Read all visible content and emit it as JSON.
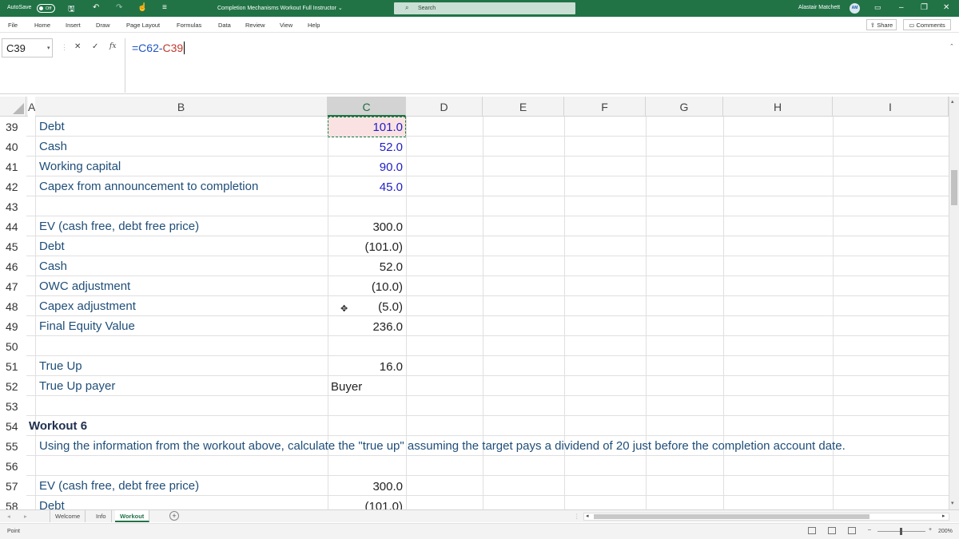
{
  "titlebar": {
    "autosave_label": "AutoSave",
    "autosave_state": "Off",
    "document_title": "Completion Mechanisms Workout Full Instructor",
    "title_dropdown_glyph": "⌄",
    "search_label": "Search",
    "user_name": "Alastair Matchett",
    "user_initials": "AM"
  },
  "menu": {
    "items": [
      "File",
      "Home",
      "Insert",
      "Draw",
      "Page Layout",
      "Formulas",
      "Data",
      "Review",
      "View",
      "Help"
    ],
    "share_label": "Share",
    "comments_label": "Comments"
  },
  "formula_bar": {
    "name_box": "C39",
    "formula_part1": "=C62-",
    "formula_part2": "C39"
  },
  "columns": [
    "A",
    "B",
    "C",
    "D",
    "E",
    "F",
    "G",
    "H",
    "I"
  ],
  "rows": [
    {
      "num": "39",
      "label": "Debt",
      "value": "101.0",
      "style": "blue"
    },
    {
      "num": "40",
      "label": "Cash",
      "value": "52.0",
      "style": "blue"
    },
    {
      "num": "41",
      "label": "Working capital",
      "value": "90.0",
      "style": "blue"
    },
    {
      "num": "42",
      "label": "Capex from announcement to completion",
      "value": "45.0",
      "style": "blue"
    },
    {
      "num": "43",
      "label": "",
      "value": "",
      "style": ""
    },
    {
      "num": "44",
      "label": "EV (cash free, debt free price)",
      "value": "300.0",
      "style": ""
    },
    {
      "num": "45",
      "label": "Debt",
      "value": "(101.0)",
      "style": ""
    },
    {
      "num": "46",
      "label": "Cash",
      "value": "52.0",
      "style": ""
    },
    {
      "num": "47",
      "label": "OWC adjustment",
      "value": "(10.0)",
      "style": ""
    },
    {
      "num": "48",
      "label": "Capex adjustment",
      "value": "(5.0)",
      "style": ""
    },
    {
      "num": "49",
      "label": "Final Equity Value",
      "value": "236.0",
      "style": ""
    },
    {
      "num": "50",
      "label": "",
      "value": "",
      "style": ""
    },
    {
      "num": "51",
      "label": "True Up",
      "value": "16.0",
      "style": ""
    },
    {
      "num": "52",
      "label": "True Up payer",
      "value": "Buyer",
      "style": "left"
    },
    {
      "num": "53",
      "label": "",
      "value": "",
      "style": ""
    },
    {
      "num": "54",
      "heading": "Workout 6"
    },
    {
      "num": "55",
      "long_text": "Using the information from the workout above, calculate the \"true up\" assuming the target pays a dividend of 20 just before the completion account date."
    },
    {
      "num": "56",
      "label": "",
      "value": "",
      "style": ""
    },
    {
      "num": "57",
      "label": "EV (cash free, debt free price)",
      "value": "300.0",
      "style": ""
    },
    {
      "num": "58",
      "label": "Debt",
      "value": "(101.0)",
      "style": ""
    }
  ],
  "sheet_tabs": [
    "Welcome",
    "Info",
    "Workout"
  ],
  "active_sheet": "Workout",
  "status": {
    "mode": "Point",
    "zoom": "200%"
  }
}
